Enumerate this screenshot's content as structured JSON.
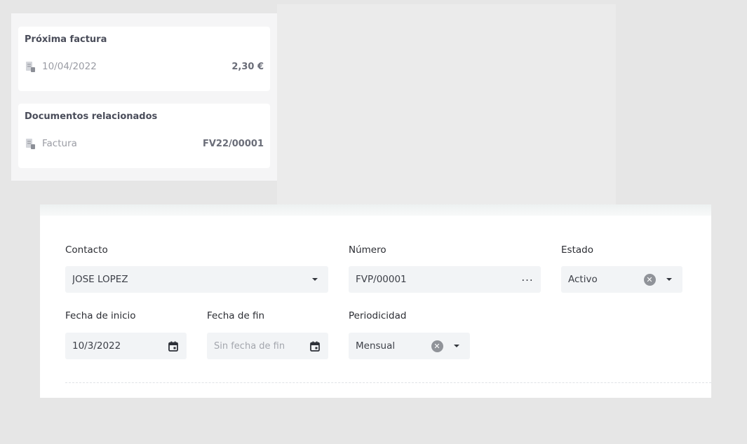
{
  "side_cards": {
    "next_invoice": {
      "title": "Próxima factura",
      "icon": "document-icon",
      "date": "10/04/2022",
      "amount": "2,30 €"
    },
    "related_docs": {
      "title": "Documentos relacionados",
      "icon": "document-icon",
      "type": "Factura",
      "number": "FV22/00001"
    }
  },
  "form": {
    "contacto": {
      "label": "Contacto",
      "value": "JOSE LOPEZ"
    },
    "numero": {
      "label": "Número",
      "value": "FVP/00001",
      "more_icon": "ellipsis-icon"
    },
    "estado": {
      "label": "Estado",
      "value": "Activo"
    },
    "fecha_inicio": {
      "label": "Fecha de inicio",
      "value": "10/3/2022",
      "icon": "calendar-icon"
    },
    "fecha_fin": {
      "label": "Fecha de fin",
      "placeholder": "Sin fecha de fin",
      "icon": "calendar-icon"
    },
    "periodicidad": {
      "label": "Periodicidad",
      "value": "Mensual"
    }
  },
  "colors": {
    "field_bg": "#f2f4f6",
    "clear_btn": "#909399"
  }
}
